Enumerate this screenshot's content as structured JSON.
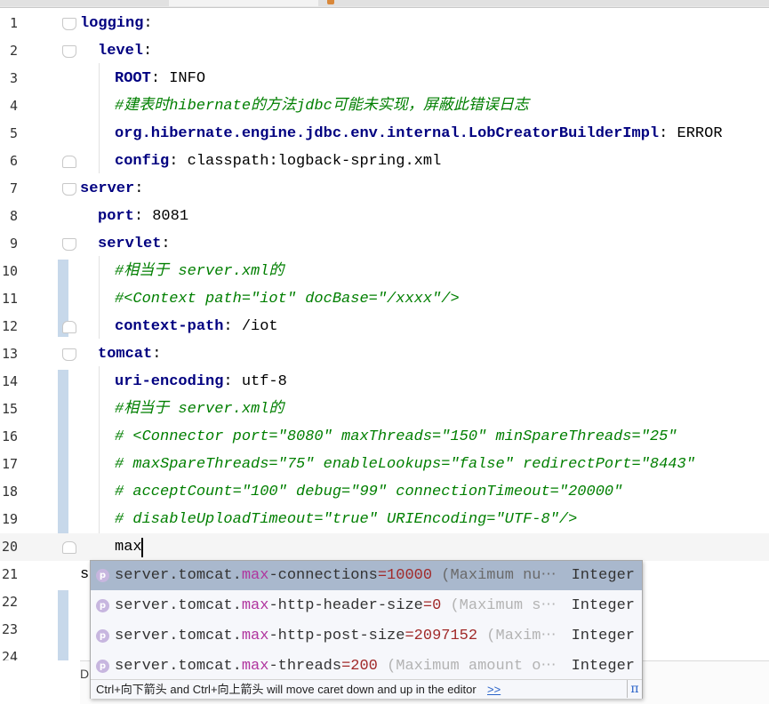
{
  "lines": [
    {
      "num": "1",
      "key": "logging",
      "val": "",
      "indent": 0
    },
    {
      "num": "2",
      "key": "level",
      "val": "",
      "indent": 1
    },
    {
      "num": "3",
      "key": "ROOT",
      "val": " INFO",
      "indent": 2
    },
    {
      "num": "4",
      "comment": "#建表时hibernate的方法jdbc可能未实现，屏蔽此错误日志",
      "indent": 2
    },
    {
      "num": "5",
      "key": "org.hibernate.engine.jdbc.env.internal.LobCreatorBuilderImpl",
      "val": " ERROR",
      "indent": 2
    },
    {
      "num": "6",
      "key": "config",
      "val": " classpath:logback-spring.xml",
      "indent": 2
    },
    {
      "num": "7",
      "key": "server",
      "val": "",
      "indent": 0
    },
    {
      "num": "8",
      "key": "port",
      "val": " 8081",
      "indent": 1
    },
    {
      "num": "9",
      "key": "servlet",
      "val": "",
      "indent": 1
    },
    {
      "num": "10",
      "comment": "#相当于 server.xml的",
      "indent": 2
    },
    {
      "num": "11",
      "comment": "#<Context path=\"iot\" docBase=\"/xxxx\"/>",
      "indent": 2
    },
    {
      "num": "12",
      "key": "context-path",
      "val": " /iot",
      "indent": 2
    },
    {
      "num": "13",
      "key": "tomcat",
      "val": "",
      "indent": 1
    },
    {
      "num": "14",
      "key": "uri-encoding",
      "val": " utf-8",
      "indent": 2
    },
    {
      "num": "15",
      "comment": "#相当于 server.xml的",
      "indent": 2
    },
    {
      "num": "16",
      "comment": "# <Connector port=\"8080\" maxThreads=\"150\" minSpareThreads=\"25\"",
      "indent": 2
    },
    {
      "num": "17",
      "comment": "# maxSpareThreads=\"75\" enableLookups=\"false\" redirectPort=\"8443\"",
      "indent": 2
    },
    {
      "num": "18",
      "comment": "# acceptCount=\"100\" debug=\"99\" connectionTimeout=\"20000\"",
      "indent": 2
    },
    {
      "num": "19",
      "comment": "# disableUploadTimeout=\"true\" URIEncoding=\"UTF-8\"/>",
      "indent": 2
    },
    {
      "num": "20",
      "plain": "max",
      "indent": 2
    },
    {
      "num": "21",
      "plain": "s",
      "indent": 0
    },
    {
      "num": "22",
      "plain": "",
      "indent": 0
    },
    {
      "num": "23",
      "plain": "",
      "indent": 0
    },
    {
      "num": "24",
      "plain": "",
      "indent": 0
    }
  ],
  "completion": {
    "items": [
      {
        "icon": "p",
        "prefix": "server.tomcat.",
        "match": "max",
        "rest": "-connections",
        "value": "=10000",
        "doc": " (Maximum nu⋯",
        "type": "Integer"
      },
      {
        "icon": "p",
        "prefix": "server.tomcat.",
        "match": "max",
        "rest": "-http-header-size",
        "value": "=0",
        "doc": " (Maximum s⋯",
        "type": "Integer"
      },
      {
        "icon": "p",
        "prefix": "server.tomcat.",
        "match": "max",
        "rest": "-http-post-size",
        "value": "=2097152",
        "doc": " (Maxim⋯",
        "type": "Integer"
      },
      {
        "icon": "p",
        "prefix": "server.tomcat.",
        "match": "max",
        "rest": "-threads",
        "value": "=200",
        "doc": " (Maximum amount o⋯",
        "type": "Integer"
      }
    ],
    "hint_text": "Ctrl+向下箭头 and Ctrl+向上箭头 will move caret down and up in the editor",
    "hint_link": ">>",
    "pi": "π"
  },
  "bottom_label": "D",
  "colors": {
    "key": "#000080",
    "comment": "#808080",
    "accent": "#2a63c9",
    "selection": "#a9b8cd"
  }
}
